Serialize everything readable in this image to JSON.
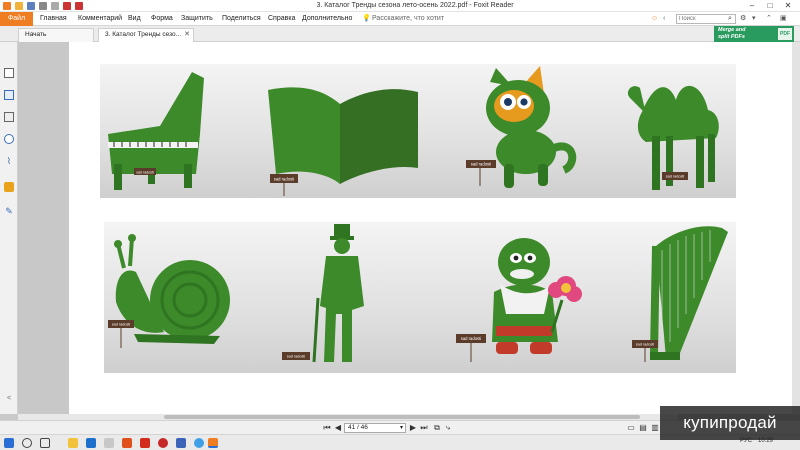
{
  "window": {
    "title": "3. Каталог Тренды сезона лето-осень 2022.pdf - Foxit Reader"
  },
  "ribbon": {
    "file_label": "Файл",
    "menu": [
      "Главная",
      "Комментарий",
      "Вид",
      "Форма",
      "Защитить",
      "Поделиться",
      "Справка",
      "Дополнительно"
    ],
    "tell_me": "Расскажите, что хотит",
    "search_placeholder": "Поиск"
  },
  "tabs": [
    {
      "label": "Начать"
    },
    {
      "label": "3. Каталог Тренды сезо..."
    }
  ],
  "banner": {
    "line1": "Merge and",
    "line2": "split PDFs",
    "badge": "PDF"
  },
  "document": {
    "plate_text": "sad radosti",
    "row1_items": [
      "piano",
      "book",
      "cat",
      "camel"
    ],
    "row2_items": [
      "snail",
      "gentleman",
      "gnome-with-flower",
      "harp"
    ]
  },
  "statusbar": {
    "page_indicator": "41 / 46"
  },
  "taskbar": {
    "tray_lang": "РУС",
    "tray_time": "10:29"
  },
  "watermark": {
    "text": "купипродай"
  },
  "colors": {
    "accent": "#ef7d22",
    "banner": "#2a9b5f",
    "topiary": "#3d8a2a"
  }
}
